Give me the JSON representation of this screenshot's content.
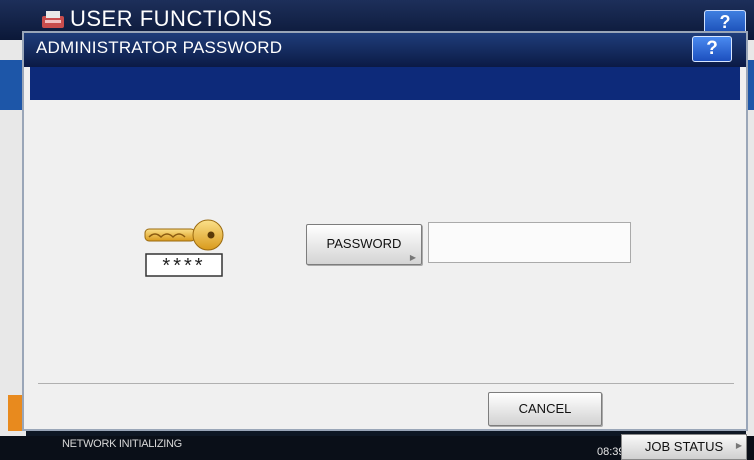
{
  "background": {
    "title": "USER FUNCTIONS",
    "help_label": "?"
  },
  "dialog": {
    "title": "ADMINISTRATOR PASSWORD",
    "help_label": "?",
    "password_button_label": "PASSWORD",
    "password_value": "",
    "cancel_label": "CANCEL"
  },
  "icons": {
    "key_mask": "****"
  },
  "status_bar": {
    "status_text": "NETWORK INITIALIZING",
    "time": "08:39",
    "job_status_label": "JOB STATUS"
  },
  "colors": {
    "header_blue": "#1f3d7a",
    "band_navy": "#0d2a7a",
    "help_blue": "#2a66d6",
    "panel_gray": "#f0f0f0",
    "key_gold": "#e8b035"
  }
}
